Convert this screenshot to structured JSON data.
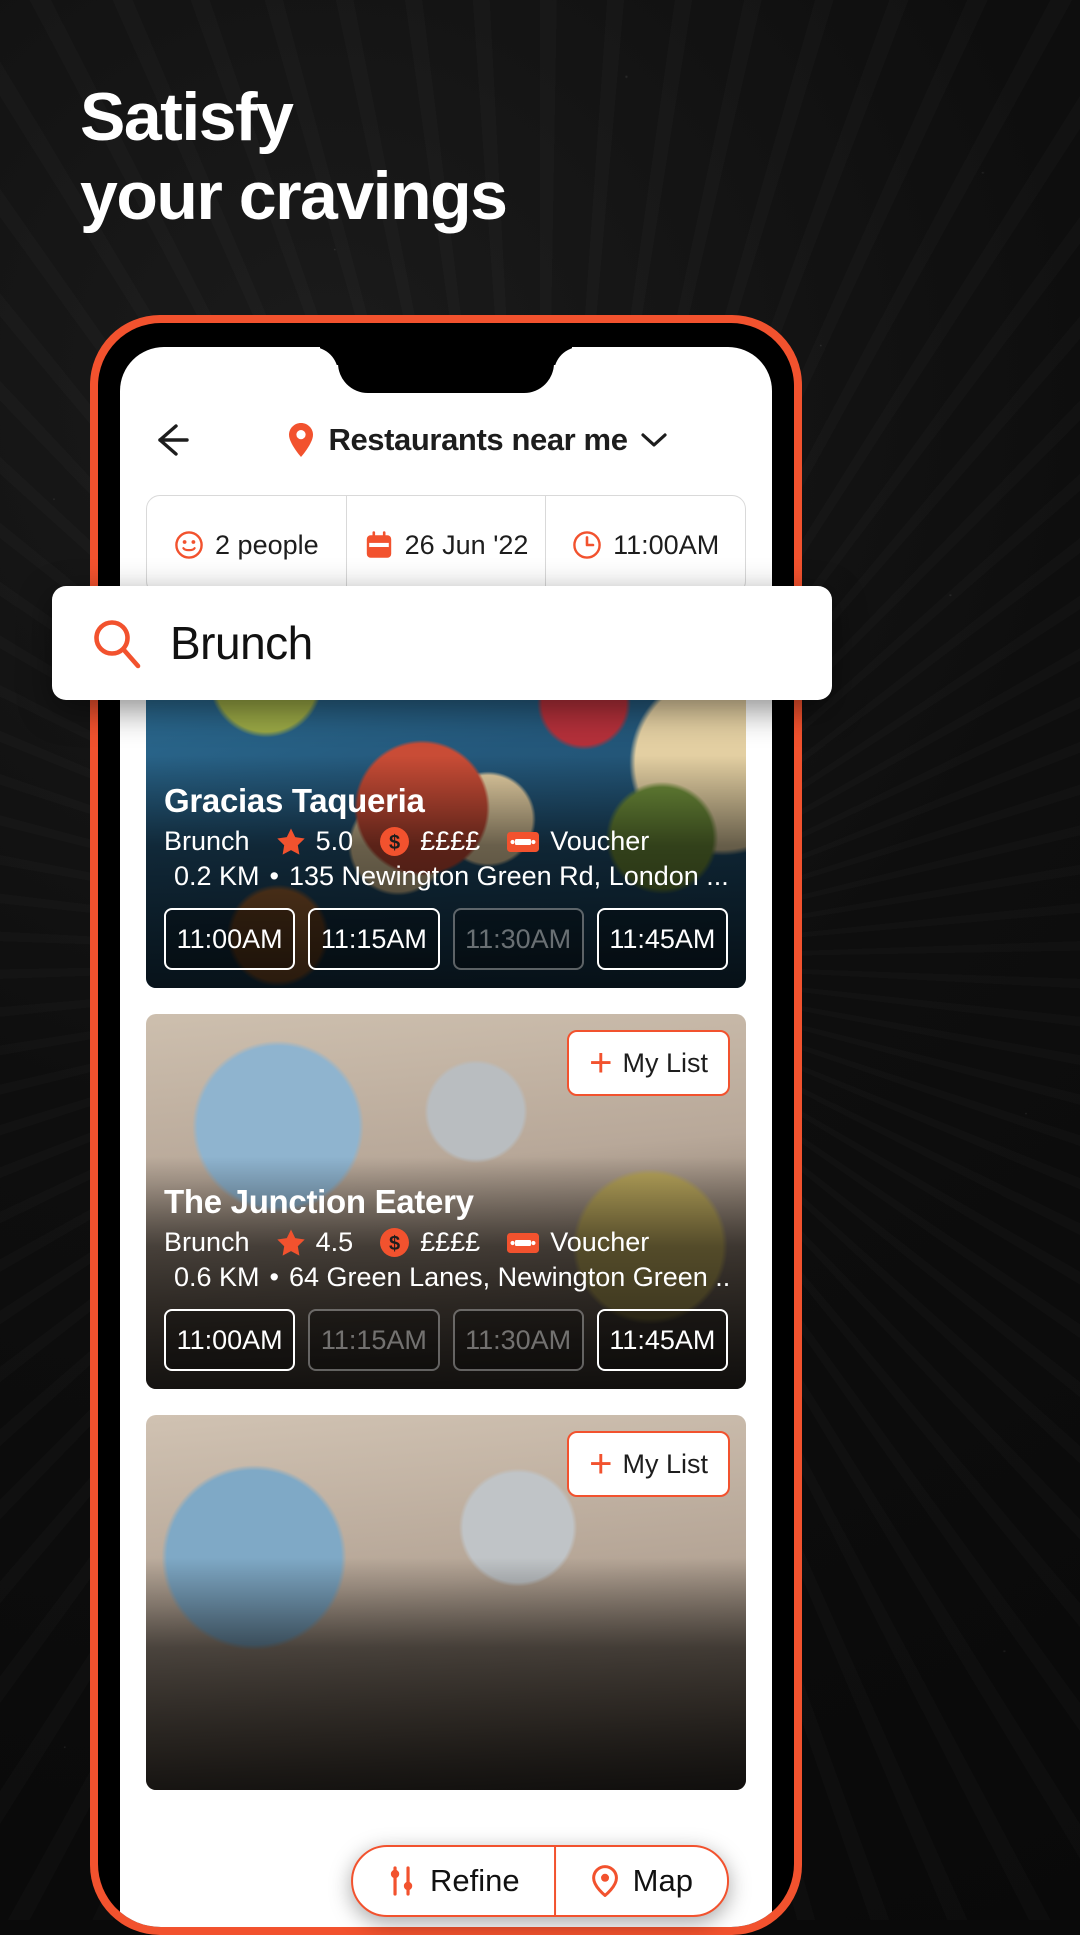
{
  "accent": "#F2522E",
  "headline": "Satisfy\nyour cravings",
  "app": {
    "header": {
      "back_icon": "arrow-left-icon",
      "pin_icon": "location-pin-icon",
      "title": "Restaurants near me",
      "chevron_icon": "chevron-down-icon"
    },
    "filters": [
      {
        "icon": "smiley-face-icon",
        "label": "2 people"
      },
      {
        "icon": "calendar-icon",
        "label": "26 Jun '22"
      },
      {
        "icon": "clock-icon",
        "label": "11:00AM"
      }
    ],
    "search": {
      "icon": "search-icon",
      "value": "Brunch",
      "placeholder": "Search"
    },
    "mylist_label": "My List",
    "mylist_plus": "+",
    "restaurants": [
      {
        "name": "Gracias Taqueria",
        "category": "Brunch",
        "rating": "5.0",
        "price": "££££",
        "voucher": "Voucher",
        "distance": "0.2 KM",
        "bullet": "•",
        "address": "135 Newington Green Rd, London ...",
        "slots": [
          {
            "time": "11:00AM",
            "available": true
          },
          {
            "time": "11:15AM",
            "available": true
          },
          {
            "time": "11:30AM",
            "available": false
          },
          {
            "time": "11:45AM",
            "available": true
          }
        ]
      },
      {
        "name": "The Junction Eatery",
        "category": "Brunch",
        "rating": "4.5",
        "price": "££££",
        "voucher": "Voucher",
        "distance": "0.6 KM",
        "bullet": "•",
        "address": "64 Green Lanes, Newington Green ...",
        "slots": [
          {
            "time": "11:00AM",
            "available": true
          },
          {
            "time": "11:15AM",
            "available": false
          },
          {
            "time": "11:30AM",
            "available": false
          },
          {
            "time": "11:45AM",
            "available": true
          }
        ]
      }
    ],
    "bottom_bar": [
      {
        "icon": "refine-sliders-icon",
        "label": "Refine"
      },
      {
        "icon": "map-pin-icon",
        "label": "Map"
      }
    ]
  }
}
